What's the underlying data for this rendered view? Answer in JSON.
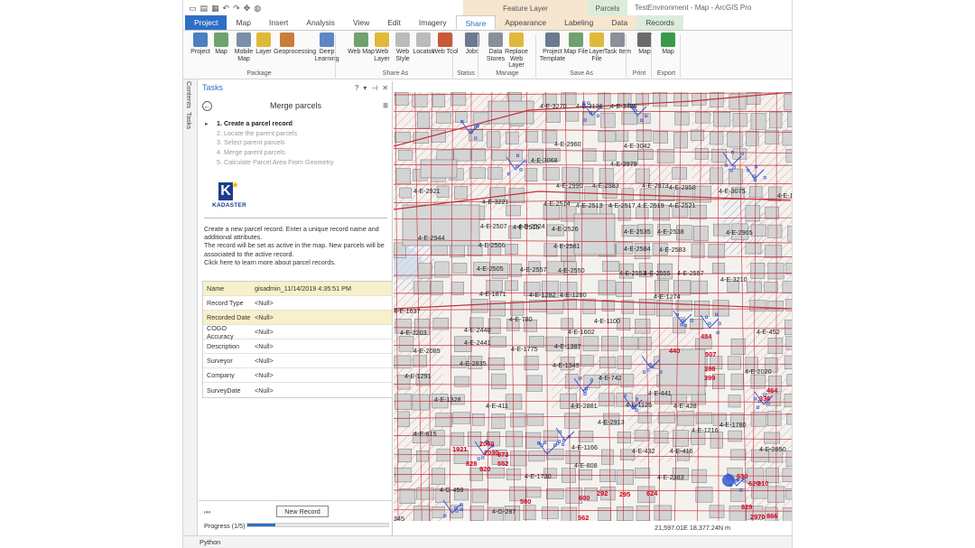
{
  "window": {
    "title": "TestEnvironment - Map - ArcGIS Pro",
    "contextual_feature_layer": "Feature Layer",
    "contextual_parcels": "Parcels"
  },
  "tabs": [
    "Project",
    "Map",
    "Insert",
    "Analysis",
    "View",
    "Edit",
    "Imagery",
    "Share",
    "Appearance",
    "Labeling",
    "Data",
    "Records"
  ],
  "active_tab": "Share",
  "ribbon": {
    "buttons": [
      {
        "label": "Project",
        "icon": "project-icon",
        "color": "#4a7fc1"
      },
      {
        "label": "Map",
        "icon": "map-icon",
        "color": "#6fa26f"
      },
      {
        "label": "Mobile Map",
        "icon": "mobile-map-icon",
        "color": "#7a8fa8"
      },
      {
        "label": "Layer",
        "icon": "layer-icon",
        "color": "#e0b93a"
      },
      {
        "label": "Geoprocessing",
        "icon": "geoprocessing-icon",
        "color": "#c87d3a"
      },
      {
        "label": "Deep Learning",
        "icon": "deep-learning-icon",
        "color": "#5d86c4"
      },
      {
        "label": "Web Map",
        "icon": "web-map-icon",
        "color": "#6fa26f"
      },
      {
        "label": "Web Layer",
        "icon": "web-layer-icon",
        "color": "#e0b93a"
      },
      {
        "label": "Web Style",
        "icon": "web-style-icon",
        "color": "#bbbbbb"
      },
      {
        "label": "Locator",
        "icon": "locator-icon",
        "color": "#bbbbbb"
      },
      {
        "label": "Web Tool",
        "icon": "web-tool-icon",
        "color": "#c9573a"
      },
      {
        "label": "Jobs",
        "icon": "jobs-icon",
        "color": "#6b7a8f"
      },
      {
        "label": "Data Stores",
        "icon": "data-stores-icon",
        "color": "#8a8f99"
      },
      {
        "label": "Replace Web Layer",
        "icon": "replace-web-layer-icon",
        "color": "#e0b93a"
      },
      {
        "label": "Project Template",
        "icon": "project-template-icon",
        "color": "#6b7a8f"
      },
      {
        "label": "Map File",
        "icon": "map-file-icon",
        "color": "#6fa26f"
      },
      {
        "label": "Layer File",
        "icon": "layer-file-icon",
        "color": "#e0b93a"
      },
      {
        "label": "Task Item",
        "icon": "task-item-icon",
        "color": "#8a8f99"
      },
      {
        "label": "Map",
        "icon": "print-map-icon",
        "color": "#6b6b6b"
      },
      {
        "label": "Map",
        "icon": "export-map-icon",
        "color": "#3a9a4a"
      }
    ],
    "groups": [
      "Package",
      "Share As",
      "Status",
      "Manage",
      "Save As",
      "Print",
      "Export"
    ]
  },
  "side_tabs": [
    "Contents",
    "Tasks"
  ],
  "tasks": {
    "pane_title": "Tasks",
    "task_title": "Merge parcels",
    "steps": [
      "1.  Create a parcel record",
      "2.  Locate the parent parcels",
      "3.  Select parent parcels",
      "4.  Merge parent parcels",
      "5.  Calculate Parcel Area From Geometry"
    ],
    "logo_text": "KADASTER",
    "description_1": "Create a new parcel record. Enter a unique record name and additional attributes.",
    "description_2": "The record will be set as active in the map. New parcels will be associated to the active record.",
    "description_3": "Click here to learn more about parcel records.",
    "attributes": [
      {
        "key": "Name",
        "value": "gisadmin_11/14/2019 4:35:51 PM"
      },
      {
        "key": "Record Type",
        "value": "<Null>"
      },
      {
        "key": "Recorded Date",
        "value": "<Null>"
      },
      {
        "key": "COGO Accuracy",
        "value": "<Null>"
      },
      {
        "key": "Description",
        "value": "<Null>"
      },
      {
        "key": "Surveyor",
        "value": "<Null>"
      },
      {
        "key": "Company",
        "value": "<Null>"
      },
      {
        "key": "SurveyDate",
        "value": "<Null>"
      }
    ],
    "new_record_button": "New Record",
    "progress_label": "Progress (1/5)",
    "progress_fraction": 0.2
  },
  "map": {
    "labels": [
      "4-E-3270",
      "4-E-3136",
      "4-E-3486",
      "4-E-2960",
      "4-E-3042",
      "4-E-3068",
      "4-E-2979",
      "4-E-2921",
      "4-E-3221",
      "4-E-2990",
      "4-E-2983",
      "4-E-2973",
      "4-E-2958",
      "4-E-3075",
      "4-E-2515",
      "4-E-2514",
      "4-E-2513",
      "4-E-2517",
      "4-E-2519",
      "4-E-2521",
      "4-E-2944",
      "4-E-2507",
      "4-E-2524",
      "4-E-2526",
      "4-E-2535",
      "4-E-2538",
      "4-E-2905",
      "4-E-2506",
      "4-E-2581",
      "4-E-2584",
      "4-E-2583",
      "4-E-2505",
      "4-E-2557",
      "4-E-2550",
      "4-E-2553",
      "4-E-2555",
      "4-E-2557",
      "4-E-1871",
      "4-E-1282",
      "4-E-1280",
      "4-E-1274",
      "4-E-1637",
      "4-E-780",
      "4-E-1100",
      "4-E-2203",
      "4-E-2440",
      "4-E-1602",
      "4-E-2441",
      "4-E-2085",
      "4-E-1775",
      "4-E-1387",
      "4-E-2835",
      "4-E-1349",
      "4-E-1291",
      "4-E-742",
      "4-E-441",
      "4-E-1328",
      "4-E-411",
      "4-E-2881",
      "4-E-1125",
      "4-E-438",
      "4-E-2913",
      "4-E-1780",
      "4-E-1216",
      "4-E-1166",
      "4-E-432",
      "4-E-416",
      "4-E-2850",
      "4-E-808",
      "4-E-1730",
      "4-E-2383",
      "4-E-452",
      "4-E-2020",
      "4-E-3210",
      "4-E-1449",
      "4-E-615",
      "4-G-459",
      "4-G-287",
      "345"
    ],
    "parcel_numbers": [
      "440",
      "484",
      "507",
      "398",
      "399",
      "464",
      "336",
      "630",
      "620",
      "580",
      "292",
      "295",
      "600",
      "562",
      "624",
      "310",
      "866",
      "829",
      "873",
      "1921",
      "828",
      "2040",
      "2030",
      "2970",
      "920",
      "552"
    ],
    "coordinates": "21,597.01E 18,377.24N m"
  },
  "status": {
    "python": "Python"
  },
  "colors": {
    "accent": "#2d6fc4",
    "parcel_line": "#c2303a",
    "hatch": "#e6a9ad",
    "building": "#d2d2d2",
    "highlight_row": "#f7f0c8"
  }
}
